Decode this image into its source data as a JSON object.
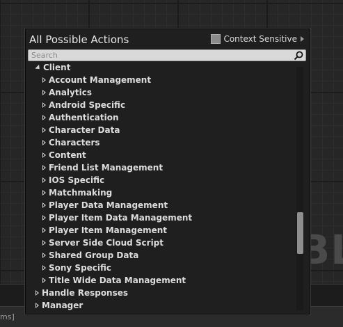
{
  "background": {
    "watermark": "BLU",
    "bottom_text": "ms]"
  },
  "menu": {
    "title": "All Possible Actions",
    "context_label": "Context Sensitive",
    "context_checked": false,
    "search": {
      "value": "",
      "placeholder": "Search"
    },
    "items": [
      {
        "label": "Client",
        "expanded": true,
        "depth": 1
      },
      {
        "label": "Account Management",
        "expanded": false,
        "depth": 2
      },
      {
        "label": "Analytics",
        "expanded": false,
        "depth": 2
      },
      {
        "label": "Android Specific",
        "expanded": false,
        "depth": 2
      },
      {
        "label": "Authentication",
        "expanded": false,
        "depth": 2
      },
      {
        "label": "Character Data",
        "expanded": false,
        "depth": 2
      },
      {
        "label": "Characters",
        "expanded": false,
        "depth": 2
      },
      {
        "label": "Content",
        "expanded": false,
        "depth": 2
      },
      {
        "label": "Friend List Management",
        "expanded": false,
        "depth": 2
      },
      {
        "label": "IOS Specific",
        "expanded": false,
        "depth": 2
      },
      {
        "label": "Matchmaking",
        "expanded": false,
        "depth": 2
      },
      {
        "label": "Player Data Management",
        "expanded": false,
        "depth": 2
      },
      {
        "label": "Player Item Data Management",
        "expanded": false,
        "depth": 2
      },
      {
        "label": "Player Item Management",
        "expanded": false,
        "depth": 2
      },
      {
        "label": "Server Side Cloud Script",
        "expanded": false,
        "depth": 2
      },
      {
        "label": "Shared Group Data",
        "expanded": false,
        "depth": 2
      },
      {
        "label": "Sony Specific",
        "expanded": false,
        "depth": 2
      },
      {
        "label": "Title Wide Data Management",
        "expanded": false,
        "depth": 2
      },
      {
        "label": "Handle Responses",
        "expanded": false,
        "depth": 1
      },
      {
        "label": "Manager",
        "expanded": false,
        "depth": 1
      }
    ],
    "scroll": {
      "position_fraction": 0.72,
      "visible_fraction": 0.17
    }
  }
}
